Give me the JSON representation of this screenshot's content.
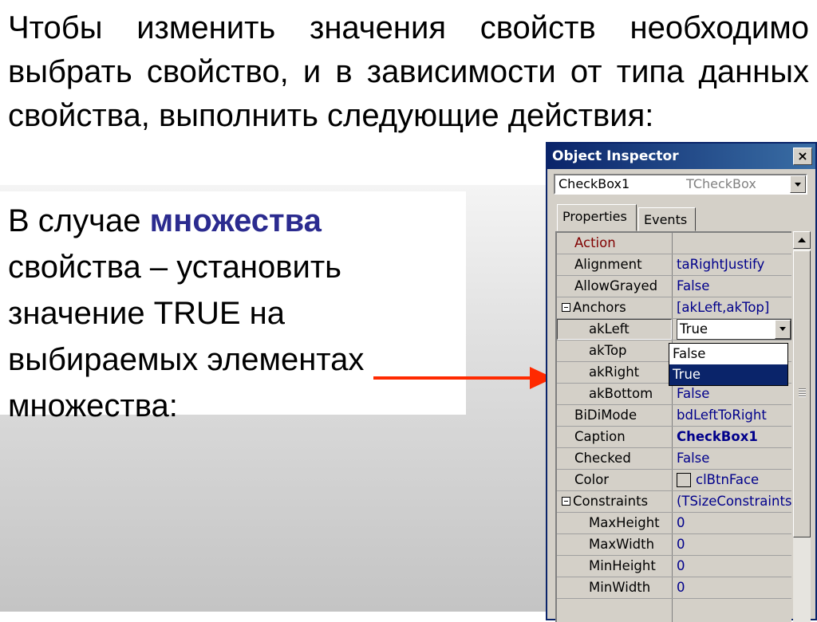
{
  "slide": {
    "heading": "Чтобы изменить значения свойств необходимо выбрать свойство, и в зависимости от типа данных свойства, выполнить следующие действия:",
    "callout_before": "В случае ",
    "callout_em": "множества",
    "callout_after": " свойства – установить значение TRUE на выбираемых элементах множества:",
    "accent_color": "#2b2b8f",
    "arrow_color": "#ff2a00"
  },
  "inspector": {
    "title": "Object Inspector",
    "close_label": "×",
    "component_name": "CheckBox1",
    "component_class": "TCheckBox",
    "tabs": [
      "Properties",
      "Events"
    ],
    "rows": [
      {
        "name": "Action",
        "value": ""
      },
      {
        "name": "Alignment",
        "value": "taRightJustify"
      },
      {
        "name": "AllowGrayed",
        "value": "False"
      },
      {
        "name": "Anchors",
        "value": "[akLeft,akTop]"
      },
      {
        "name": "akLeft",
        "value": "True"
      },
      {
        "name": "akTop",
        "value": ""
      },
      {
        "name": "akRight",
        "value": ""
      },
      {
        "name": "akBottom",
        "value": "False"
      },
      {
        "name": "BiDiMode",
        "value": "bdLeftToRight"
      },
      {
        "name": "Caption",
        "value": "CheckBox1"
      },
      {
        "name": "Checked",
        "value": "False"
      },
      {
        "name": "Color",
        "value": "clBtnFace"
      },
      {
        "name": "Constraints",
        "value": "(TSizeConstraints)"
      },
      {
        "name": "MaxHeight",
        "value": "0"
      },
      {
        "name": "MaxWidth",
        "value": "0"
      },
      {
        "name": "MinHeight",
        "value": "0"
      },
      {
        "name": "MinWidth",
        "value": "0"
      }
    ],
    "dropdown_options": [
      "False",
      "True"
    ],
    "dropdown_selected": "True",
    "selection_color": "#0a246a",
    "value_color": "#00008b"
  }
}
